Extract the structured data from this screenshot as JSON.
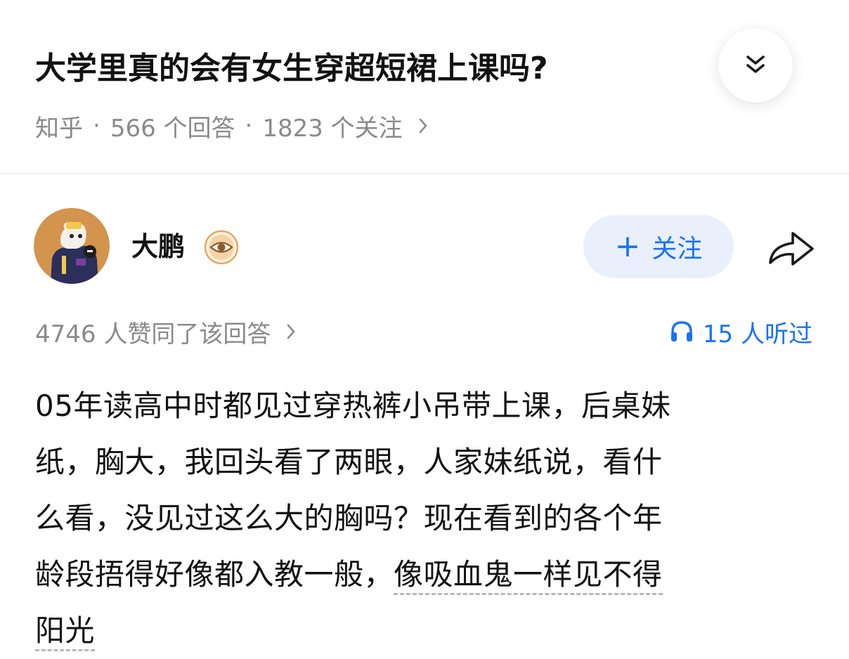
{
  "question": {
    "title": "大学里真的会有女生穿超短裙上课吗?",
    "source": "知乎",
    "separator": "·",
    "answers_count": "566 个回答",
    "followers_count": "1823 个关注"
  },
  "author": {
    "name": "大鹏",
    "follow_plus": "+",
    "follow_label": "关注"
  },
  "answer_stats": {
    "upvotes_text": "4746 人赞同了该回答",
    "listened_text": "15 人听过"
  },
  "answer": {
    "line1": "05年读高中时都见过穿热裤小吊带上课，后桌妹",
    "line2": "纸，胸大，我回头看了两眼，人家妹纸说，看什",
    "line3": "么看，没见过这么大的胸吗？现在看到的各个年",
    "line4_plain": "龄段捂得好像都入教一般，",
    "line4_link": "像吸血鬼一样见不得",
    "line5_link": "阳光"
  },
  "colors": {
    "accent_blue": "#1772f6",
    "follow_bg": "#eaf0fb",
    "meta_gray": "#8a8a8a",
    "title_black": "#121212",
    "badge_orange": "#e8a65c"
  },
  "icons": {
    "collapse": "double-chevron-down-icon",
    "meta_chevron": "chevron-right-icon",
    "badge": "eye-badge-icon",
    "share": "share-arrow-icon",
    "listen": "headphone-icon"
  }
}
